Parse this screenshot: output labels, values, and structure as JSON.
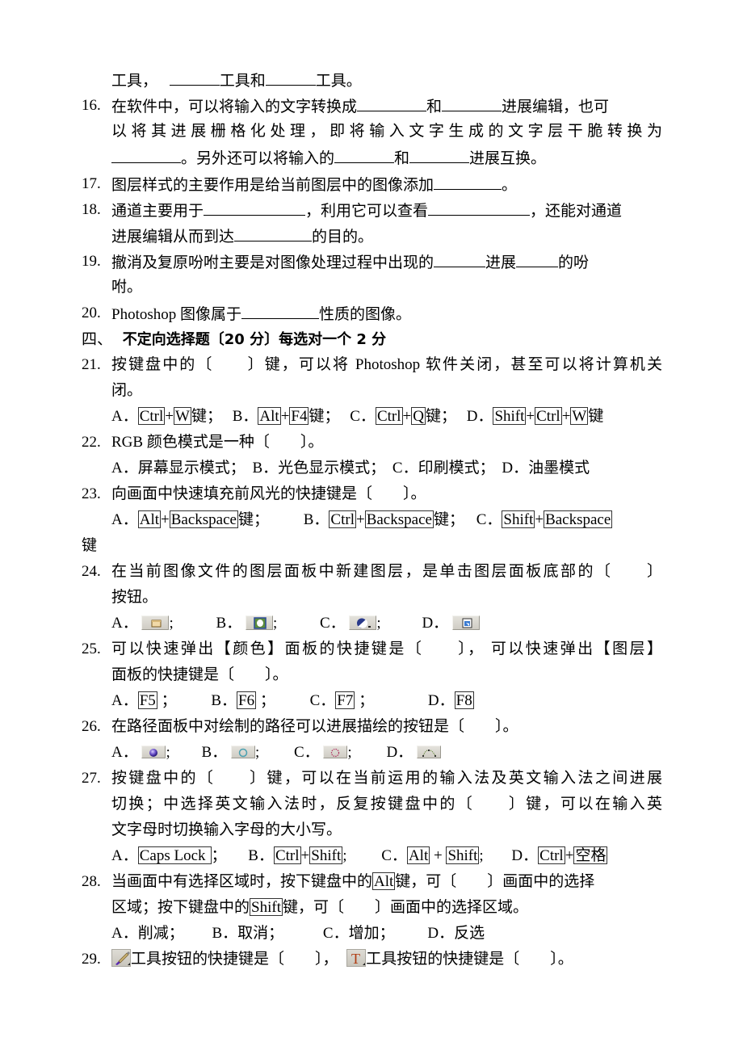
{
  "document": {
    "lines": {
      "l0": {
        "a": "工具，",
        "b": "工具和",
        "c": "工具。"
      },
      "q16": {
        "num": "16.",
        "l1a": "在软件中，可以将输入的文字转换成",
        "l1b": "和",
        "l1c": "进展编辑，也可",
        "l2": "以将其进展栅格化处理，即将输入文字生成的文字层干脆转换为",
        "l3a": "。另外还可以将输入的",
        "l3b": "和",
        "l3c": "进展互换。"
      },
      "q17": {
        "num": "17.",
        "a": "图层样式的主要作用是给当前图层中的图像添加",
        "b": "。"
      },
      "q18": {
        "num": "18.",
        "l1a": "通道主要用于",
        "l1b": "，利用它可以查看",
        "l1c": "，还能对通道",
        "l2a": "进展编辑从而到达",
        "l2b": "的目的。"
      },
      "q19": {
        "num": "19.",
        "l1a": "撤消及复原吩咐主要是对图像处理过程中出现的",
        "l1b": "进展",
        "l1c": "的吩",
        "l2": "咐。"
      },
      "q20": {
        "num": "20.",
        "a": "Photoshop 图像属于",
        "b": "性质的图像。"
      }
    },
    "section4": {
      "prefix": "四、",
      "title": "不定向选择题〔20 分〕每选对一个 2 分"
    },
    "questions": {
      "q21": {
        "num": "21.",
        "l1": "按键盘中的〔　　〕键，可以将 Photoshop 软件关闭，甚至可以将计算机关",
        "l2": "闭。",
        "options": {
          "a_label": "A．",
          "a_keys": [
            "Ctrl",
            "W"
          ],
          "a_suffix": "键；",
          "b_label": "B．",
          "b_keys": [
            "Alt",
            "F4"
          ],
          "b_suffix": "键；",
          "c_label": "C．",
          "c_keys": [
            "Ctrl",
            "Q"
          ],
          "c_suffix": "键；",
          "d_label": "D．",
          "d_keys": [
            "Shift",
            "Ctrl",
            "W"
          ],
          "d_suffix": "键"
        }
      },
      "q22": {
        "num": "22.",
        "l1": "RGB 颜色模式是一种〔　　〕。",
        "options": {
          "a": "A．屏幕显示模式；",
          "b": "B．光色显示模式；",
          "c": "C．印刷模式；",
          "d": "D．油墨模式"
        }
      },
      "q23": {
        "num": "23.",
        "l1": "向画面中快速填充前风光的快捷键是〔　　〕。",
        "options": {
          "a_label": "A．",
          "a_keys": [
            "Alt",
            "Backspace"
          ],
          "a_suffix": "键；",
          "b_label": "B．",
          "b_keys": [
            "Ctrl",
            "Backspace"
          ],
          "b_suffix": "键；",
          "c_label": "C．",
          "c_keys": [
            "Shift",
            "Backspace"
          ]
        },
        "wrap": "键"
      },
      "q24": {
        "num": "24.",
        "l1": "在当前图像文件的图层面板中新建图层，是单击图层面板底部的〔　　〕",
        "l2": "按钮。",
        "options": {
          "a_label": "A．",
          "a_icon": "new-layer-folder-icon",
          "b_label": "B．",
          "b_icon": "layer-mask-icon",
          "c_label": "C．",
          "c_icon": "adjustment-layer-icon",
          "d_label": "D．",
          "d_icon": "new-layer-page-icon",
          "sep": ";"
        }
      },
      "q25": {
        "num": "25.",
        "l1": "可以快速弹出【颜色】面板的快捷键是〔　　〕，  可以快速弹出【图层】",
        "l2": "面板的快捷键是〔　　〕。",
        "options": {
          "a_label": "A．",
          "a_key": "F5",
          "b_label": "B．",
          "b_key": "F6",
          "c_label": "C．",
          "c_key": "F7",
          "d_label": "D．",
          "d_key": "F8",
          "sep": "；"
        }
      },
      "q26": {
        "num": "26.",
        "l1": "在路径面板中对绘制的路径可以进展描绘的按钮是〔　　〕。",
        "options": {
          "a_label": "A．",
          "a_icon": "fill-path-icon",
          "b_label": "B．",
          "b_icon": "stroke-path-icon",
          "c_label": "C．",
          "c_icon": "load-path-as-selection-icon",
          "d_label": "D．",
          "d_icon": "make-work-path-icon",
          "sep": ";"
        }
      },
      "q27": {
        "num": "27.",
        "l1": "按键盘中的〔　　〕键，可以在当前运用的输入法及英文输入法之间进展",
        "l2": "切换；中选择英文输入法时，反复按键盘中的〔　　〕键，可以在输入英",
        "l3": "文字母时切换输入字母的大小写。",
        "options": {
          "a_label": "A．",
          "a_keys": [
            "Caps Lock"
          ],
          "a_suffix": "；",
          "b_label": "B．",
          "b_keys": [
            "Ctrl",
            "Shift"
          ],
          "b_suffix": ";",
          "c_label": "C．",
          "c_keys": [
            "Alt",
            "Shift"
          ],
          "c_suffix": ";",
          "d_label": "D．",
          "d_keys": [
            "Ctrl",
            "空格"
          ]
        }
      },
      "q28": {
        "num": "28.",
        "l1a": "当画面中有选择区域时，按下键盘中的",
        "l1_key": "Alt",
        "l1b": "键，可〔　　〕画面中的选择",
        "l2a": "区域；按下键盘中的",
        "l2_key": "Shift",
        "l2b": "键，可〔　　〕画面中的选择区域。",
        "options": {
          "a": "A．削减；",
          "b": "B．取消；",
          "c": "C．增加；",
          "d": "D．反选"
        }
      },
      "q29": {
        "num": "29.",
        "icon1": "brush-tool-icon",
        "text1": "工具按钮的快捷键是〔　　〕，",
        "icon2": "type-tool-icon",
        "text2": "工具按钮的快捷键是〔　　〕。"
      }
    }
  }
}
